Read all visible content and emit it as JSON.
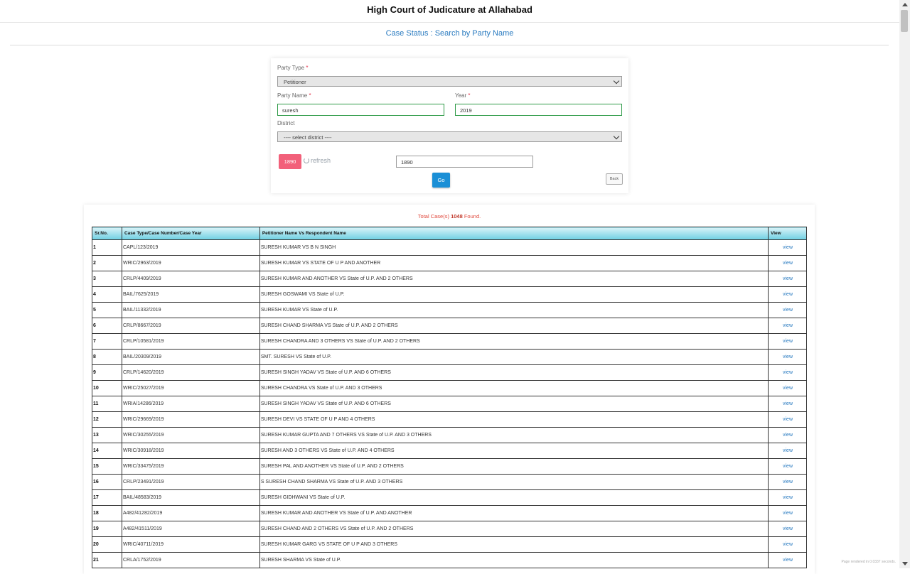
{
  "header": {
    "title": "High Court of Judicature at Allahabad"
  },
  "page": {
    "subtitle": "Case Status : Search by Party Name"
  },
  "form": {
    "party_type_label": "Party Type",
    "party_type_value": "Petitioner",
    "party_name_label": "Party Name",
    "party_name_value": "suresh",
    "year_label": "Year",
    "year_value": "2019",
    "district_label": "District",
    "district_value": "---- select district ----",
    "required_mark": "*",
    "captcha_text": "1890",
    "refresh_label": "refresh",
    "captcha_input_value": "1890",
    "go_label": "Go",
    "back_label": "Back"
  },
  "results": {
    "total_prefix": "Total Case(s)",
    "total_count": "1048",
    "total_suffix": "Found.",
    "columns": [
      "Sr.No.",
      "Case Type/Case Number/Case Year",
      "Petitioner Name Vs Respondent Name",
      "View"
    ],
    "view_label": "view",
    "rows": [
      {
        "sr": "1",
        "case": "CAPL/123/2019",
        "parties": "SURESH KUMAR VS B N SINGH"
      },
      {
        "sr": "2",
        "case": "WRIC/2963/2019",
        "parties": "SURESH KUMAR VS STATE OF U P AND ANOTHER"
      },
      {
        "sr": "3",
        "case": "CRLP/4409/2019",
        "parties": "SURESH KUMAR AND ANOTHER VS State of U.P. AND 2 OTHERS"
      },
      {
        "sr": "4",
        "case": "BAIL/7625/2019",
        "parties": "SURESH GOSWAMI VS State of U.P."
      },
      {
        "sr": "5",
        "case": "BAIL/11332/2019",
        "parties": "SURESH KUMAR VS State of U.P."
      },
      {
        "sr": "6",
        "case": "CRLP/8667/2019",
        "parties": "SURESH CHAND SHARMA VS State of U.P. AND 2 OTHERS"
      },
      {
        "sr": "7",
        "case": "CRLP/10581/2019",
        "parties": "SURESH CHANDRA AND 3 OTHERS VS State of U.P. AND 2 OTHERS"
      },
      {
        "sr": "8",
        "case": "BAIL/20309/2019",
        "parties": "SMT. SURESH VS State of U.P."
      },
      {
        "sr": "9",
        "case": "CRLP/14620/2019",
        "parties": "SURESH SINGH YADAV VS State of U.P. AND 6 OTHERS"
      },
      {
        "sr": "10",
        "case": "WRIC/25027/2019",
        "parties": "SURESH CHANDRA VS State of U.P. AND 3 OTHERS"
      },
      {
        "sr": "11",
        "case": "WRIA/14286/2019",
        "parties": "SURESH SINGH YADAV VS State of U.P. AND 6 OTHERS"
      },
      {
        "sr": "12",
        "case": "WRIC/29669/2019",
        "parties": "SURESH DEVI VS STATE OF U P AND 4 OTHERS"
      },
      {
        "sr": "13",
        "case": "WRIC/30255/2019",
        "parties": "SURESH KUMAR GUPTA AND 7 OTHERS VS State of U.P. AND 3 OTHERS"
      },
      {
        "sr": "14",
        "case": "WRIC/30918/2019",
        "parties": "SURESH AND 3 OTHERS VS State of U.P. AND 4 OTHERS"
      },
      {
        "sr": "15",
        "case": "WRIC/33475/2019",
        "parties": "SURESH PAL AND ANOTHER VS State of U.P. AND 2 OTHERS"
      },
      {
        "sr": "16",
        "case": "CRLP/23491/2019",
        "parties": "S SURESH CHAND SHARMA VS State of U.P. AND 3 OTHERS"
      },
      {
        "sr": "17",
        "case": "BAIL/48583/2019",
        "parties": "SURESH GIDHWANI VS State of U.P."
      },
      {
        "sr": "18",
        "case": "A482/41282/2019",
        "parties": "SURESH KUMAR AND ANOTHER VS State of U.P. AND ANOTHER"
      },
      {
        "sr": "19",
        "case": "A482/41511/2019",
        "parties": "SURESH CHAND AND 2 OTHERS VS State of U.P. AND 2 OTHERS"
      },
      {
        "sr": "20",
        "case": "WRIC/40711/2019",
        "parties": "SURESH KUMAR GARG VS STATE OF U P AND 3 OTHERS"
      },
      {
        "sr": "21",
        "case": "CRLA/1752/2019",
        "parties": "SURESH SHARMA VS State of U.P."
      }
    ]
  },
  "footer": {
    "render_prefix": "Page rendered in",
    "render_value": "0.0337",
    "render_suffix": "seconds."
  }
}
